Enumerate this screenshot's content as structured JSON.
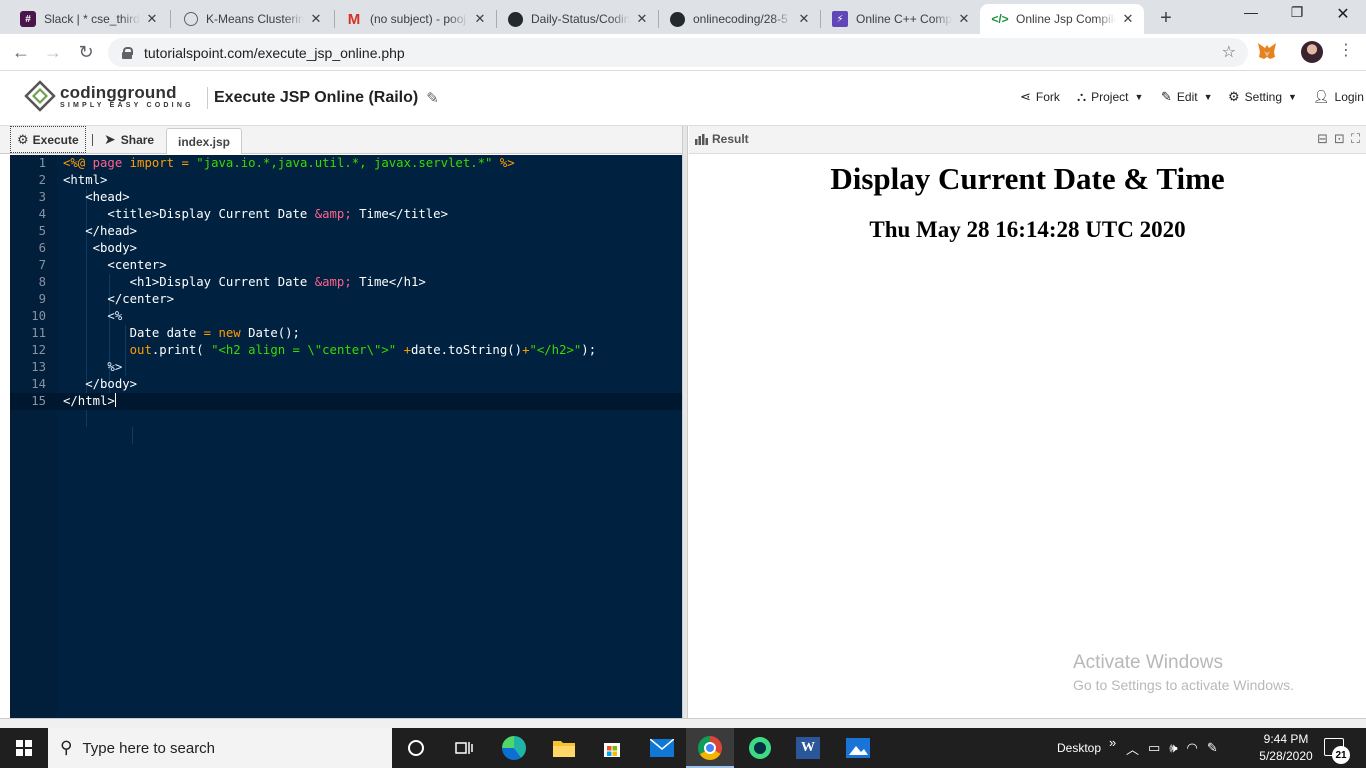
{
  "browser": {
    "tabs": [
      {
        "title": "Slack | * cse_third_",
        "close": "✕"
      },
      {
        "title": "K-Means Clustering",
        "close": "✕"
      },
      {
        "title": "(no subject) - pooj",
        "close": "✕"
      },
      {
        "title": "Daily-Status/Codin",
        "close": "✕"
      },
      {
        "title": "onlinecoding/28-5",
        "close": "✕"
      },
      {
        "title": "Online C++ Comp",
        "close": "✕"
      },
      {
        "title": "Online Jsp Compile",
        "close": "✕"
      }
    ],
    "new_tab": "+",
    "window_controls": {
      "minimize": "—",
      "restore": "❐",
      "close": "✕"
    },
    "url": "tutorialspoint.com/execute_jsp_online.php"
  },
  "header": {
    "logo_main": "codingground",
    "logo_sub": "SIMPLY EASY CODING",
    "title": "Execute JSP Online (Railo)",
    "menu": {
      "fork": "Fork",
      "project": "Project",
      "edit": "Edit",
      "setting": "Setting",
      "login": "Login"
    }
  },
  "toolbar": {
    "execute": "Execute",
    "share": "Share",
    "file_tab": "index.jsp"
  },
  "editor": {
    "line_numbers": [
      "1",
      "2",
      "3",
      "4",
      "5",
      "6",
      "7",
      "8",
      "9",
      "10",
      "11",
      "12",
      "13",
      "14",
      "15"
    ]
  },
  "result": {
    "label": "Result",
    "heading": "Display Current Date & Time",
    "datetime": "Thu May 28 16:14:28 UTC 2020"
  },
  "watermark": {
    "line1": "Activate Windows",
    "line2": "Go to Settings to activate Windows."
  },
  "taskbar": {
    "search_placeholder": "Type here to search",
    "desktop_label": "Desktop",
    "desktop_chevron": "»",
    "time": "9:44 PM",
    "date": "5/28/2020",
    "notifications": "21"
  },
  "colors": {
    "editor_bg": "#002240",
    "tab_strip": "#dee1e6",
    "taskbar": "#1f1f1f"
  }
}
